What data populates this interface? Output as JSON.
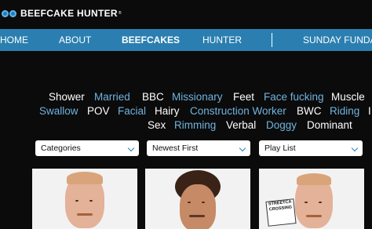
{
  "header": {
    "logo_text": "BEEFCAKE HUNTER",
    "logo_tm": "®"
  },
  "nav": {
    "items": [
      {
        "label": "HOME"
      },
      {
        "label": "ABOUT"
      },
      {
        "label": "BEEFCAKES",
        "active": true
      },
      {
        "label": "HUNTER"
      },
      {
        "label": "SUNDAY FUNDA"
      }
    ]
  },
  "tags": {
    "row1": [
      "Shower",
      "Married",
      "BBC",
      "Missionary",
      "Feet",
      "Face fucking",
      "Muscle"
    ],
    "row2": [
      "Swallow",
      "POV",
      "Facial",
      "Hairy",
      "Construction Worker",
      "BWC",
      "Riding",
      "I"
    ],
    "row3": [
      "Sex",
      "Rimming",
      "Verbal",
      "Doggy",
      "Dominant"
    ]
  },
  "filters": {
    "categories": "Categories",
    "sort": "Newest First",
    "playlist": "Play List"
  },
  "thumbnails": {
    "sign_text": "STREETCA CROSSING"
  },
  "colors": {
    "nav_bg": "#2b7fb0",
    "tag_blue": "#6fb3df",
    "page_bg": "#0b0b0b"
  }
}
